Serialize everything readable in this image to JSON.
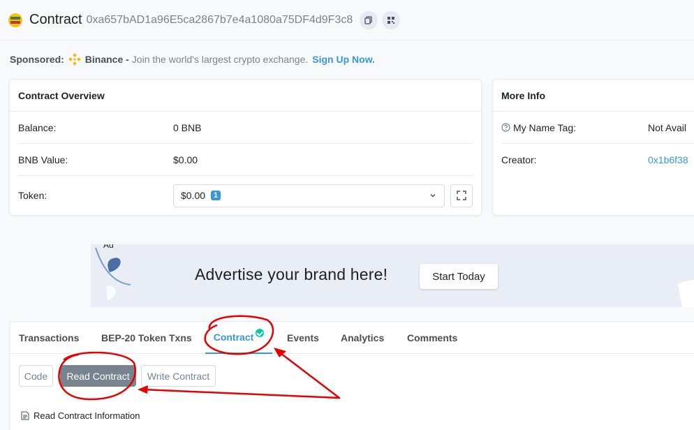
{
  "header": {
    "title": "Contract",
    "address": "0xa657bAD1a96E5ca2867b7e4a1080a75DF4d9F3c8",
    "icons": [
      "copy-icon",
      "qr-code-icon"
    ]
  },
  "sponsored": {
    "label": "Sponsored:",
    "brand": "Binance -",
    "text": "Join the world's largest crypto exchange.",
    "link": "Sign Up Now."
  },
  "overview": {
    "title": "Contract Overview",
    "rows": [
      {
        "label": "Balance:",
        "value": "0 BNB"
      },
      {
        "label": "BNB Value:",
        "value": "$0.00"
      },
      {
        "label": "Token:",
        "value": "$0.00",
        "badge": "1"
      }
    ]
  },
  "more_info": {
    "title": "More Info",
    "rows": [
      {
        "label": "My Name Tag:",
        "value": "Not Avail"
      },
      {
        "label": "Creator:",
        "value": "0x1b6f38"
      }
    ]
  },
  "ad": {
    "tag": "Ad",
    "text": "Advertise your brand here!",
    "button": "Start Today"
  },
  "tabs": [
    {
      "label": "Transactions"
    },
    {
      "label": "BEP-20 Token Txns"
    },
    {
      "label": "Contract",
      "active": true
    },
    {
      "label": "Events"
    },
    {
      "label": "Analytics"
    },
    {
      "label": "Comments"
    }
  ],
  "subtabs": [
    {
      "label": "Code"
    },
    {
      "label": "Read Contract",
      "active": true
    },
    {
      "label": "Write Contract"
    }
  ],
  "section": {
    "label": "Read Contract Information"
  },
  "colors": {
    "accent": "#3498db",
    "annotation": "#e60000",
    "verified": "#00c9a7"
  }
}
